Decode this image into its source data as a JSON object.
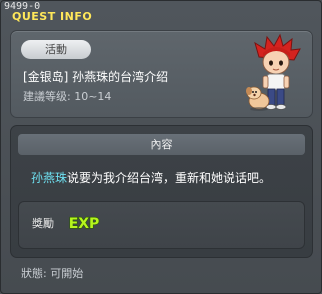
{
  "window": {
    "id": "9499-0",
    "title": "QUEST INFO"
  },
  "quest": {
    "badge": "活動",
    "name": "[金银岛] 孙燕珠的台湾介绍",
    "level_text": "建議等级: 10~14"
  },
  "content": {
    "header": "內容",
    "npc_name": "孙燕珠",
    "text_rest": "说要为我介绍台湾，重新和她说话吧。"
  },
  "reward": {
    "label": "獎勵",
    "item_icon": "exp-icon",
    "item_text": "EXP"
  },
  "status": {
    "text": "狀態:  可開始"
  },
  "colors": {
    "title": "#ffe85a",
    "npc_highlight": "#6ee0f0",
    "exp_fill": "#b6f51e"
  }
}
